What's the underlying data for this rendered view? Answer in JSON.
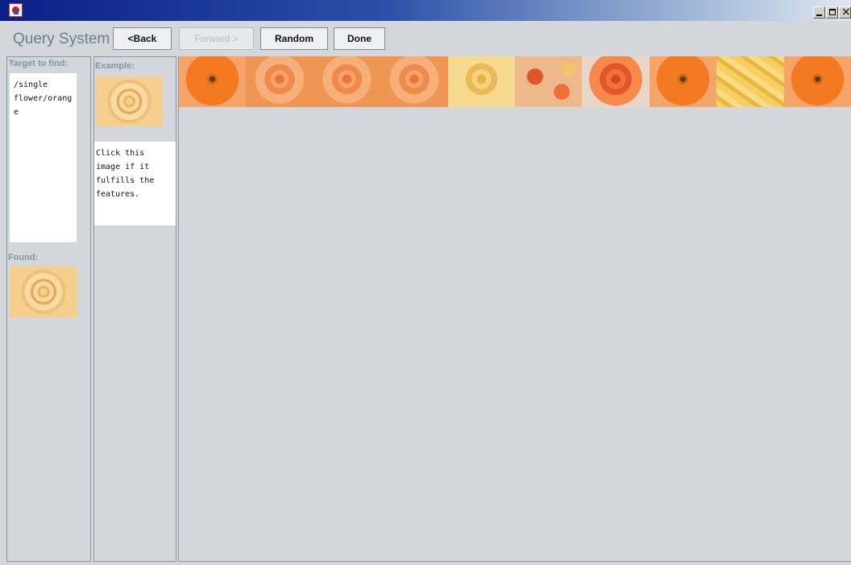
{
  "window": {
    "controls": {
      "minimize_icon": "minimize-icon",
      "maximize_icon": "maximize-icon",
      "close_icon": "close-icon"
    }
  },
  "toolbar": {
    "title": "Query System",
    "back_label": "<Back",
    "forward_label": "Forward >",
    "random_label": "Random",
    "done_label": "Done"
  },
  "left_panel": {
    "target_label": "Target to find:",
    "target_text": "/single\nflower/orang\ne",
    "found_label": "Found:"
  },
  "example_panel": {
    "label": "Example:",
    "instruction": "Click this\nimage if it\nfulfills the\nfeatures."
  },
  "results_strip": {
    "images": [
      {
        "kind": "orange gerbera"
      },
      {
        "kind": "orange rose"
      },
      {
        "kind": "orange rose"
      },
      {
        "kind": "orange rose"
      },
      {
        "kind": "yellow rose"
      },
      {
        "kind": "mixed orange flowers"
      },
      {
        "kind": "red-orange rose"
      },
      {
        "kind": "orange gerbera"
      },
      {
        "kind": "yellow petals"
      },
      {
        "kind": "orange gerbera"
      }
    ]
  },
  "colors": {
    "titlebar_start": "#0b1f86",
    "background": "#d3d6da",
    "label": "#8793a8"
  }
}
